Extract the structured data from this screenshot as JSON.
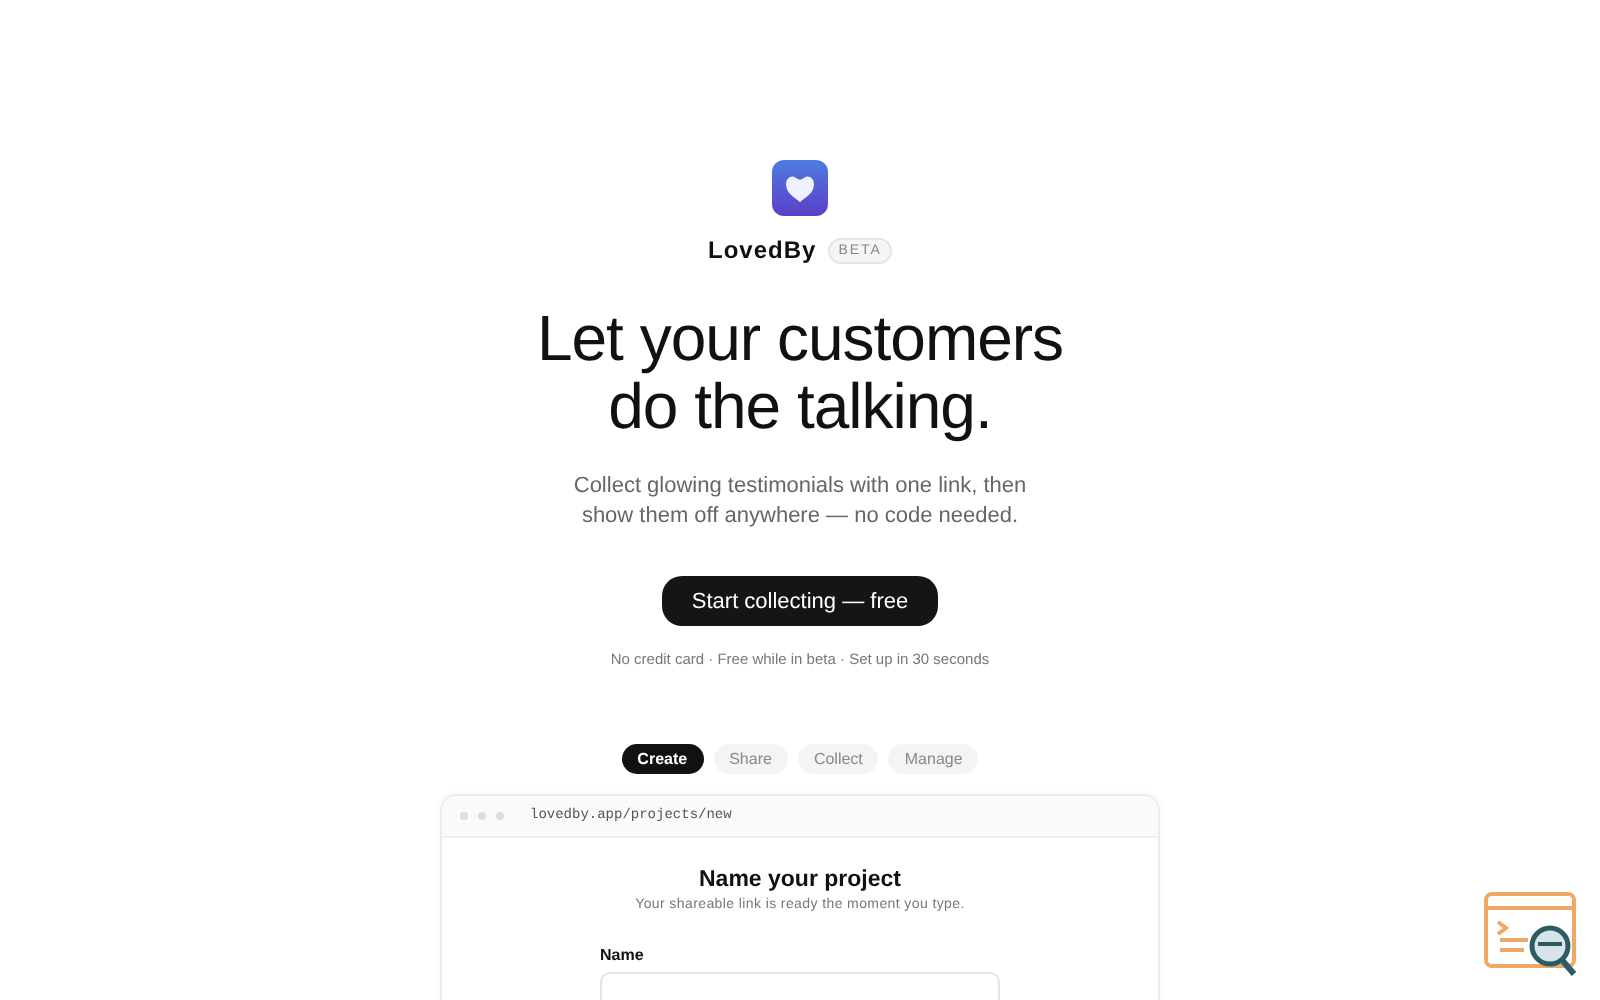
{
  "brand": {
    "name": "LovedBy",
    "badge": "BETA"
  },
  "hero": {
    "headline_lines": [
      "Let your customers",
      "do the talking."
    ],
    "subtitle_lines": [
      "Collect glowing testimonials with one link, then",
      "show them off anywhere — no code needed."
    ],
    "cta": "Start collecting — free",
    "note": "No credit card · Free while in beta · Set up in 30 seconds"
  },
  "tabs": [
    {
      "label": "Create",
      "selected": true
    },
    {
      "label": "Share",
      "selected": false
    },
    {
      "label": "Collect",
      "selected": false
    },
    {
      "label": "Manage",
      "selected": false
    }
  ],
  "preview": {
    "url": "lovedby.app/projects/new",
    "title": "Name your project",
    "subtitle": "Your shareable link is ready the moment you type.",
    "field_label": "Name"
  }
}
